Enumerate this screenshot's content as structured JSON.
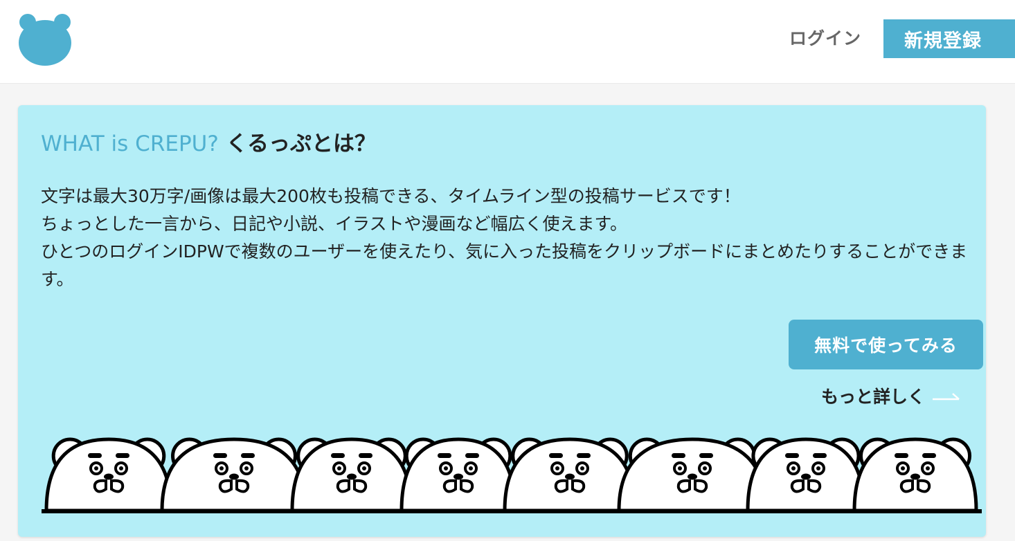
{
  "header": {
    "login_label": "ログイン",
    "register_label": "新規登録"
  },
  "intro": {
    "title_en": "WHAT is CREPU?",
    "title_jp": "くるっぷとは？",
    "paragraphs": [
      "文字は最大30万字/画像は最大200枚も投稿できる、タイムライン型の投稿サービスです！",
      "ちょっとした一言から、日記や小説、イラストや漫画など幅広く使えます。",
      "ひとつのログインIDPWで複数のユーザーを使えたり、気に入った投稿をクリップボードにまとめたりすることができます。"
    ],
    "try_button_label": "無料で使ってみる",
    "more_link_label": "もっと詳しく"
  },
  "colors": {
    "accent": "#4fb0d0",
    "panel_bg": "#b4eef7",
    "text": "#222222",
    "muted": "#666666"
  },
  "icons": {
    "logo": "bear-head-logo-icon",
    "more_link_arrow": "arrow-right-icon",
    "illustration": "bear-faces-row"
  }
}
